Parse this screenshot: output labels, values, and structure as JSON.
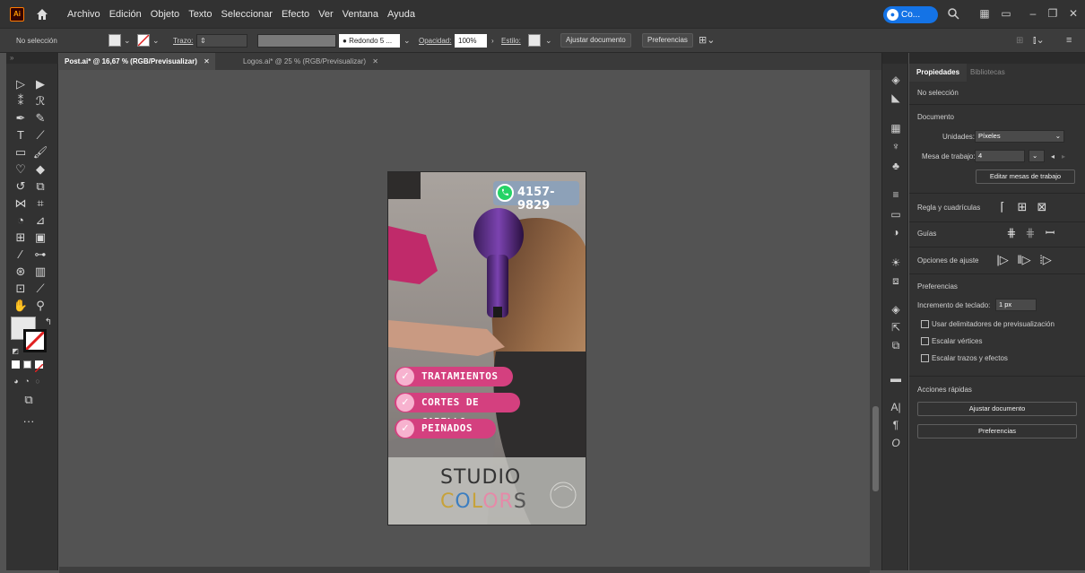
{
  "app": {
    "logo_text": "Ai"
  },
  "menu": [
    "Archivo",
    "Edición",
    "Objeto",
    "Texto",
    "Seleccionar",
    "Efecto",
    "Ver",
    "Ventana",
    "Ayuda"
  ],
  "cloud": {
    "label": "Co..."
  },
  "control_bar": {
    "selection_state": "No selección",
    "stroke_label": "Trazo:",
    "brush_label": "Redondo 5 ...",
    "opacity_label": "Opacidad:",
    "opacity_value": "100%",
    "style_label": "Estilo:",
    "fit_document_button": "Ajustar documento",
    "preferences_button": "Preferencias"
  },
  "document_tabs": [
    {
      "label": "Post.ai* @ 16,67 % (RGB/Previsualizar)",
      "active": true
    },
    {
      "label": "Logos.ai* @ 25 % (RGB/Previsualizar)",
      "active": false
    }
  ],
  "artboard": {
    "phone": "4157-9829",
    "services": [
      "TRATAMIENTOS",
      "CORTES DE CABELLO",
      "PEINADOS"
    ],
    "logo_line1": "STUDIO",
    "logo_line2": "COLORS",
    "colors": {
      "pill": "#d4407f",
      "check": "#f7b2cf",
      "badge": "#8da1b8",
      "whatsapp": "#25d366"
    }
  },
  "properties_panel": {
    "tabs": [
      "Propiedades",
      "Bibliotecas"
    ],
    "selection_state": "No selección",
    "document_section": "Documento",
    "units_label": "Unidades:",
    "units_value": "Píxeles",
    "artboard_label": "Mesa de trabajo:",
    "artboard_value": "4",
    "edit_artboards_button": "Editar mesas de trabajo",
    "rulers_grids_label": "Regla y cuadrículas",
    "guides_label": "Guías",
    "snap_options_label": "Opciones de ajuste",
    "preferences_section": "Preferencias",
    "keyboard_increment_label": "Incremento de teclado:",
    "keyboard_increment_value": "1 px",
    "checkbox_preview_bounds": "Usar delimitadores de previsualización",
    "checkbox_scale_corners": "Escalar vértices",
    "checkbox_scale_strokes": "Escalar trazos y efectos",
    "quick_actions_section": "Acciones rápidas",
    "fit_document_button": "Ajustar documento",
    "preferences_button": "Preferencias"
  }
}
